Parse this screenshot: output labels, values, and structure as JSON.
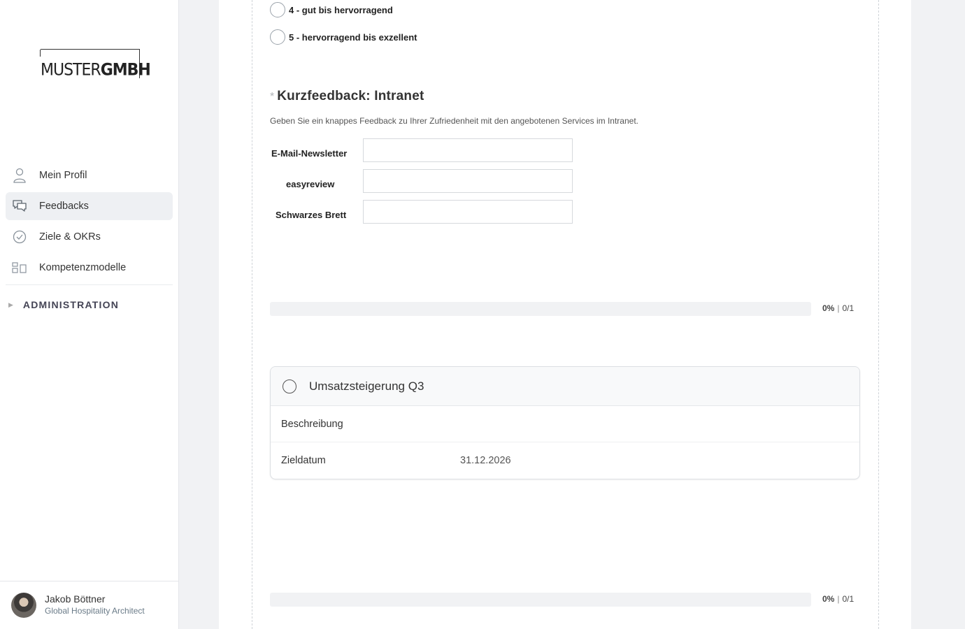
{
  "sidebar": {
    "logo": {
      "part1": "MUSTER",
      "part2": "GMBH"
    },
    "nav": [
      {
        "label": "Mein Profil",
        "icon": "user-icon",
        "active": false
      },
      {
        "label": "Feedbacks",
        "icon": "chat-icon",
        "active": true
      },
      {
        "label": "Ziele & OKRs",
        "icon": "check-circle-icon",
        "active": false
      },
      {
        "label": "Kompetenzmodelle",
        "icon": "grid-icon",
        "active": false
      }
    ],
    "admin_label": "ADMINISTRATION",
    "admin_icon": "triangle-right-icon",
    "user": {
      "name": "Jakob Böttner",
      "role": "Global Hospitality Architect"
    }
  },
  "form": {
    "options": [
      {
        "label": "4 - gut bis hervorragend"
      },
      {
        "label": "5 - hervorragend bis exzellent"
      }
    ],
    "question": {
      "required_mark": "*",
      "title": "Kurzfeedback: Intranet",
      "description": "Geben Sie ein knappes Feedback zu Ihrer Zufriedenheit mit den angebotenen Services im Intranet.",
      "fields": [
        {
          "label": "E-Mail-Newsletter",
          "value": ""
        },
        {
          "label": "easyreview",
          "value": ""
        },
        {
          "label": "Schwarzes Brett",
          "value": ""
        }
      ]
    },
    "progress1": {
      "percent_text": "0%",
      "count_text": "0/1",
      "fraction": 0
    },
    "goal": {
      "title": "Umsatzsteigerung Q3",
      "rows": [
        {
          "key": "Beschreibung",
          "value": ""
        },
        {
          "key": "Zieldatum",
          "value": "31.12.2026"
        }
      ]
    },
    "progress2": {
      "percent_text": "0%",
      "count_text": "0/1",
      "fraction": 0
    }
  },
  "colors": {
    "accent_bg": "#eef0f3",
    "progress_track": "#f1f2f4"
  }
}
